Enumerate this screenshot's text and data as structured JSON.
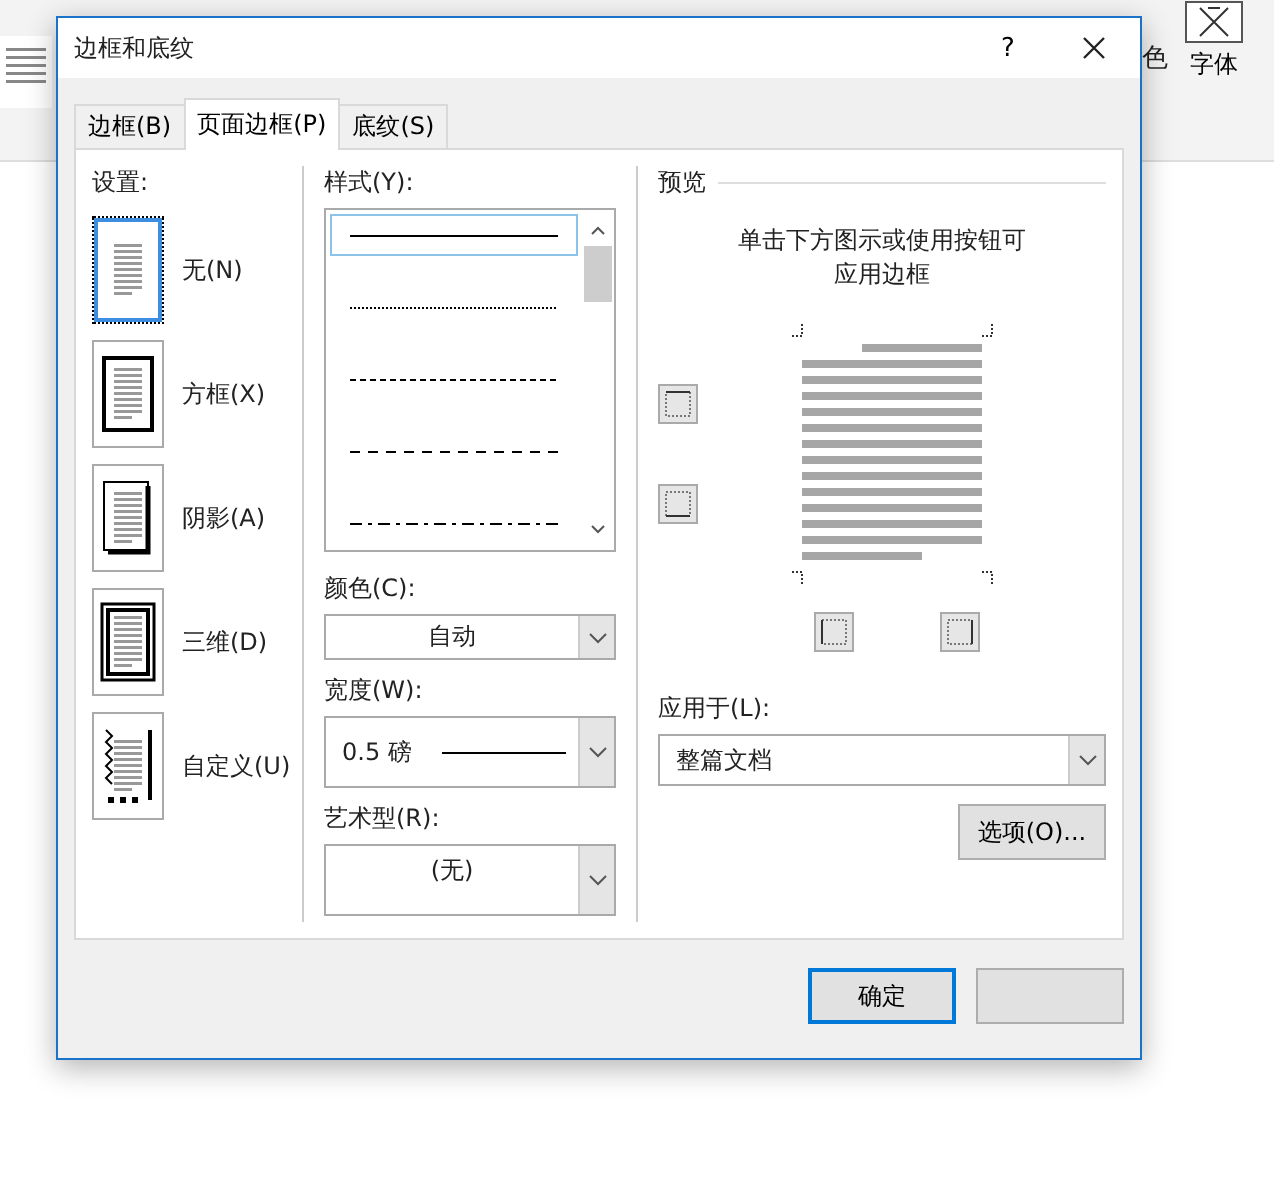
{
  "background": {
    "font_button": "字体",
    "color_label": "色"
  },
  "window": {
    "title": "边框和底纹",
    "help": "?"
  },
  "tabs": [
    {
      "label": "边框(B)",
      "selected": false
    },
    {
      "label": "页面边框(P)",
      "selected": true
    },
    {
      "label": "底纹(S)",
      "selected": false
    }
  ],
  "settings": {
    "label": "设置:",
    "items": [
      {
        "label": "无(N)",
        "kind": "none",
        "selected": true
      },
      {
        "label": "方框(X)",
        "kind": "box",
        "selected": false
      },
      {
        "label": "阴影(A)",
        "kind": "shadow",
        "selected": false
      },
      {
        "label": "三维(D)",
        "kind": "raised",
        "selected": false
      },
      {
        "label": "自定义(U)",
        "kind": "custom",
        "selected": false
      }
    ]
  },
  "style": {
    "label": "样式(Y):",
    "items": [
      {
        "kind": "solid",
        "selected": true
      },
      {
        "kind": "dotted",
        "selected": false
      },
      {
        "kind": "fine-dashed",
        "selected": false
      },
      {
        "kind": "dashed",
        "selected": false
      },
      {
        "kind": "dash-dot",
        "selected": false
      }
    ]
  },
  "color": {
    "label": "颜色(C):",
    "value": "自动"
  },
  "width": {
    "label": "宽度(W):",
    "value": "0.5 磅"
  },
  "art": {
    "label": "艺术型(R):",
    "value": "(无)"
  },
  "preview": {
    "heading": "预览",
    "hint": "单击下方图示或使用按钮可应用边框"
  },
  "apply_to": {
    "label": "应用于(L):",
    "value": "整篇文档"
  },
  "options_button": "选项(O)...",
  "footer": {
    "ok_label": "确定"
  }
}
